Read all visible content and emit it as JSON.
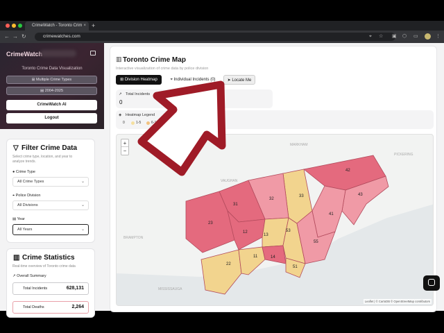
{
  "browser": {
    "tab_title": "CrimeWatch - Toronto Crim",
    "url": "crimewatches.com"
  },
  "sidebar": {
    "brand": "CrimeWatch",
    "subtitle": "Toronto Crime Data Visualization",
    "pill_types": "Multiple Crime Types",
    "pill_years": "2004-2025",
    "ai_button": "CrimeWatch AI",
    "logout_button": "Logout"
  },
  "filter": {
    "title": "Filter Crime Data",
    "description_1": "Select crime type, location, and year to",
    "description_2": "analyze trends.",
    "crime_type_label": "Crime Type",
    "crime_type_value": "All Crime Types",
    "division_label": "Police Division",
    "division_value": "All Divisions",
    "year_label": "Year",
    "year_value": "All Years"
  },
  "stats": {
    "title": "Crime Statistics",
    "description": "Real-time overview of Toronto crime data",
    "overall": "Overall Summary",
    "total_incidents_label": "Total Incidents",
    "total_incidents_value": "628,131",
    "total_deaths_label": "Total Deaths",
    "total_deaths_value": "2,264"
  },
  "map": {
    "title": "Toronto Crime Map",
    "subtitle": "Interactive visualization of crime data by police division",
    "tab_heatmap": "Division Heatmap",
    "tab_individual": "Individual Incidents (0)",
    "tab_locate": "Locate Me",
    "total_label": "Total Incidents",
    "total_value": "0",
    "legend_title": "Heatmap Legend",
    "legend_items": [
      "0",
      "1-5",
      "6-10"
    ],
    "zoom_in": "+",
    "zoom_out": "−",
    "attribution": "Leaflet | © CartoDB © OpenStreetMap contributors",
    "places": [
      "MARKHAM",
      "VAUGHAN",
      "PICKERING",
      "BRAMPTON",
      "MISSISSAUGA"
    ],
    "divisions": [
      {
        "id": "42",
        "level": "high"
      },
      {
        "id": "43",
        "level": "mid"
      },
      {
        "id": "33",
        "level": "low"
      },
      {
        "id": "32",
        "level": "mid"
      },
      {
        "id": "31",
        "level": "high"
      },
      {
        "id": "23",
        "level": "high"
      },
      {
        "id": "12",
        "level": "high"
      },
      {
        "id": "13",
        "level": "low"
      },
      {
        "id": "53",
        "level": "low"
      },
      {
        "id": "41",
        "level": "mid"
      },
      {
        "id": "55",
        "level": "mid"
      },
      {
        "id": "22",
        "level": "low"
      },
      {
        "id": "11",
        "level": "low"
      },
      {
        "id": "14",
        "level": "high"
      },
      {
        "id": "51",
        "level": "low"
      }
    ]
  },
  "colors": {
    "high": "#e46a7e",
    "mid": "#f09aa6",
    "low": "#f2d48e",
    "arrow": "#9f1b27"
  }
}
